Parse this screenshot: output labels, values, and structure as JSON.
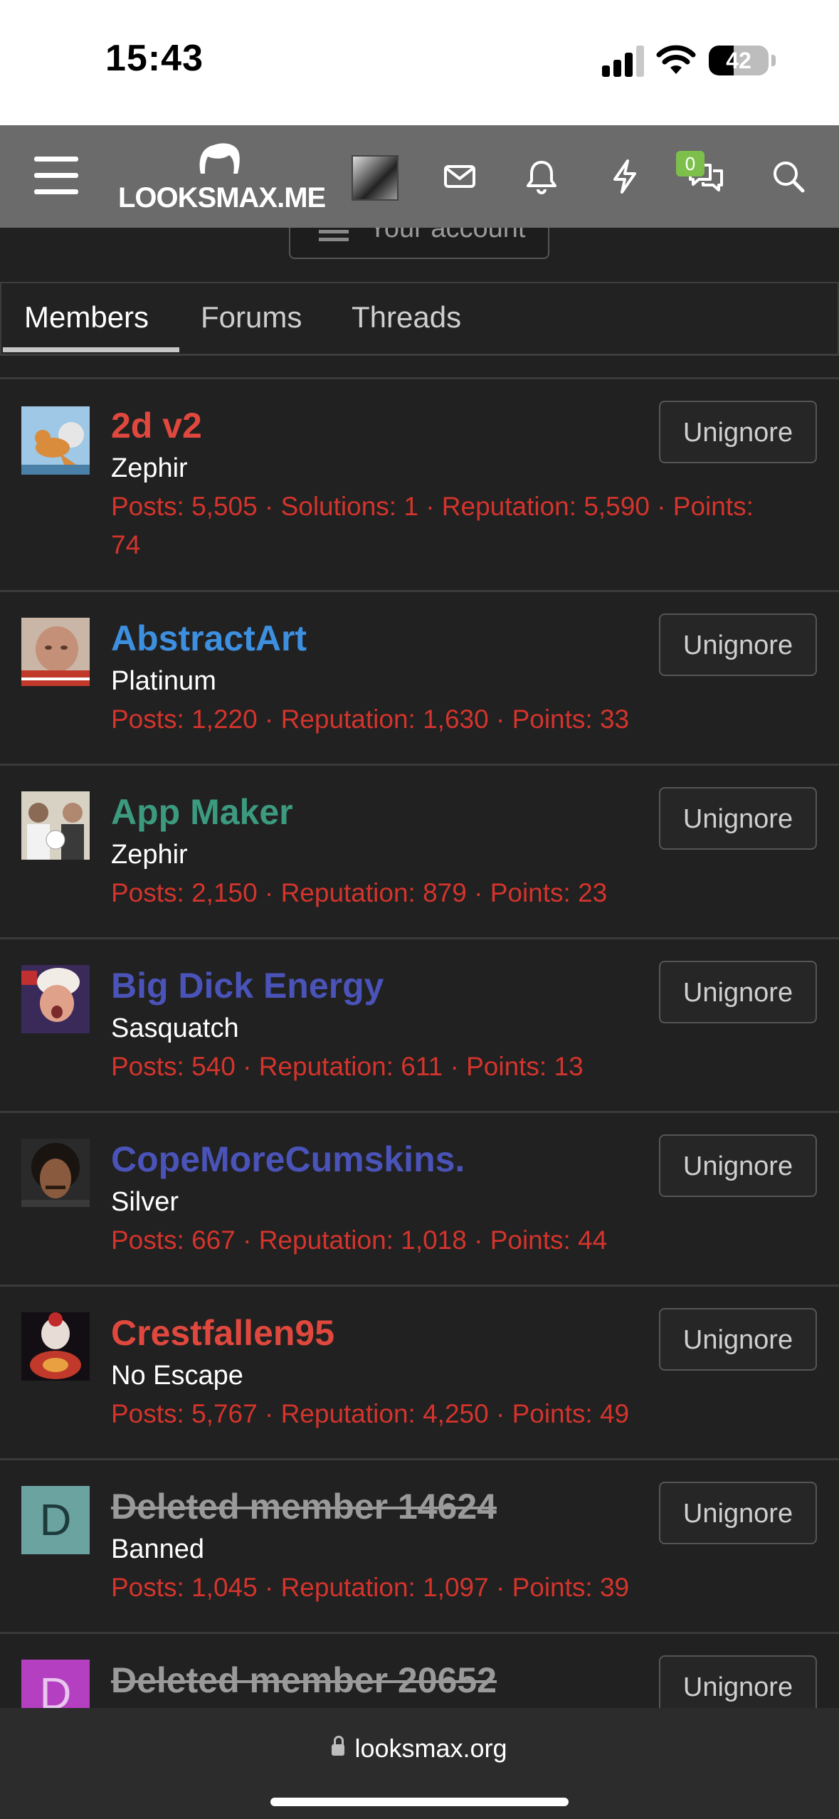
{
  "status_bar": {
    "time": "15:43",
    "battery": "42",
    "battery_level": 0.42
  },
  "nav": {
    "logo": "LOOKSMAX.ME",
    "conversations_badge": "0"
  },
  "account_button": {
    "label": "Your account"
  },
  "tabs": [
    {
      "label": "Members",
      "active": true
    },
    {
      "label": "Forums",
      "active": false
    },
    {
      "label": "Threads",
      "active": false
    }
  ],
  "members": [
    {
      "name": "2d v2",
      "name_color": "#e0483e",
      "title": "Zephir",
      "stats_line1": "Posts: 5,505 · Solutions: 1 · Reputation: 5,590 · Points:",
      "stats_line2": "74",
      "button": "Unignore",
      "avatar": "seal-drawing",
      "deleted": false
    },
    {
      "name": "AbstractArt",
      "name_color": "#3d8fe0",
      "title": "Platinum",
      "stats_line1": "Posts: 1,220 · Reputation: 1,630 · Points: 33",
      "stats_line2": "",
      "button": "Unignore",
      "avatar": "baby-photo",
      "deleted": false
    },
    {
      "name": "App Maker",
      "name_color": "#3c9a7f",
      "title": "Zephir",
      "stats_line1": "Posts: 2,150 · Reputation: 879 · Points: 23",
      "stats_line2": "",
      "button": "Unignore",
      "avatar": "group-photo",
      "deleted": false
    },
    {
      "name": "Big Dick Energy",
      "name_color": "#4a53b8",
      "title": "Sasquatch",
      "stats_line1": "Posts: 540 · Reputation: 611 · Points: 13",
      "stats_line2": "",
      "button": "Unignore",
      "avatar": "wrestler-photo",
      "deleted": false
    },
    {
      "name": "CopeMoreCumskins.",
      "name_color": "#4a53b8",
      "title": "Silver",
      "stats_line1": "Posts: 667 · Reputation: 1,018 · Points: 44",
      "stats_line2": "",
      "button": "Unignore",
      "avatar": "man-photo",
      "deleted": false
    },
    {
      "name": "Crestfallen95",
      "name_color": "#e0483e",
      "title": "No Escape",
      "stats_line1": "Posts: 5,767 · Reputation: 4,250 · Points: 49",
      "stats_line2": "",
      "button": "Unignore",
      "avatar": "clown-photo",
      "deleted": false
    },
    {
      "name": "Deleted member 14624",
      "name_color": "#9a9a9a",
      "title": "Banned",
      "stats_line1": "Posts: 1,045 · Reputation: 1,097 · Points: 39",
      "stats_line2": "",
      "button": "Unignore",
      "avatar_letter": "D",
      "avatar_color": "#6aa3a0",
      "deleted": true
    },
    {
      "name": "Deleted member 20652",
      "name_color": "#9a9a9a",
      "title": "",
      "stats_line1": "",
      "stats_line2": "",
      "button": "Unignore",
      "avatar_letter": "D",
      "avatar_color": "#b43fc0",
      "deleted": true
    }
  ],
  "safari": {
    "url": "looksmax.org"
  }
}
